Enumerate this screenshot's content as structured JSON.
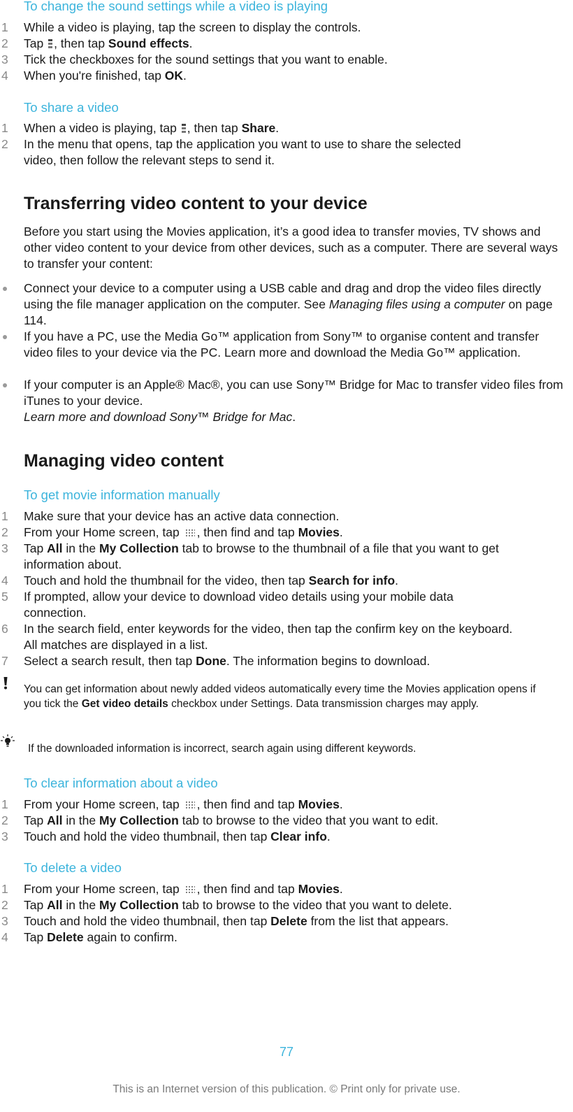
{
  "sound_settings": {
    "heading": "To change the sound settings while a video is playing",
    "steps": [
      {
        "num": "1",
        "parts": [
          "While a video is playing, tap the screen to display the controls."
        ]
      },
      {
        "num": "2",
        "a": "Tap ",
        "b": ", then tap ",
        "bold": "Sound effects",
        "c": "."
      },
      {
        "num": "3",
        "text": "Tick the checkboxes for the sound settings that you want to enable."
      },
      {
        "num": "4",
        "a": "When you're finished, tap ",
        "bold": "OK",
        "c": "."
      }
    ]
  },
  "share_video": {
    "heading": "To share a video",
    "steps": [
      {
        "num": "1",
        "a": "When a video is playing, tap ",
        "b": ", then tap ",
        "bold": "Share",
        "c": "."
      },
      {
        "num": "2",
        "text": "In the menu that opens, tap the application you want to use to share the selected video, then follow the relevant steps to send it."
      }
    ]
  },
  "transferring": {
    "heading": "Transferring video content to your device",
    "intro": "Before you start using the Movies application, it’s a good idea to transfer movies, TV shows and other video content to your device from other devices, such as a computer. There are several ways to transfer your content:",
    "bullets": [
      {
        "a": "Connect your device to a computer using a USB cable and drag and drop the video files directly using the file manager application on the computer. See ",
        "link": "Managing files using a computer",
        "c": " on page 114."
      },
      {
        "text": "If you have a PC, use the Media Go™ application from Sony™ to organise content and transfer video files to your device via the PC. Learn more and download the Media Go™ application."
      },
      {
        "a": "If your computer is an Apple® Mac®, you can use Sony™ Bridge for Mac to transfer video files from iTunes to your device.",
        "link": "Learn more and download Sony™ Bridge for Mac",
        "c": "."
      }
    ]
  },
  "managing": {
    "heading": "Managing video content",
    "get_info": {
      "heading": "To get movie information manually",
      "steps": [
        {
          "num": "1",
          "text": "Make sure that your device has an active data connection."
        },
        {
          "num": "2",
          "a": "From your Home screen, tap ",
          "b": ", then find and tap ",
          "bold": "Movies",
          "c": "."
        },
        {
          "num": "3",
          "a": "Tap ",
          "bold1": "All",
          "b": " in the ",
          "bold2": "My Collection",
          "c": " tab to browse to the thumbnail of a file that you want to get information about."
        },
        {
          "num": "4",
          "a": "Touch and hold the thumbnail for the video, then tap ",
          "bold": "Search for info",
          "c": "."
        },
        {
          "num": "5",
          "text": "If prompted, allow your device to download video details using your mobile data connection."
        },
        {
          "num": "6",
          "text": "In the search field, enter keywords for the video, then tap the confirm key on the keyboard. All matches are displayed in a list."
        },
        {
          "num": "7",
          "a": "Select a search result, then tap ",
          "bold": "Done",
          "c": ". The information begins to download."
        }
      ],
      "note": {
        "a": "You can get information about newly added videos automatically every time the Movies application opens if you tick the ",
        "bold": "Get video details",
        "c": " checkbox under Settings. Data transmission charges may apply."
      },
      "tip": "If the downloaded information is incorrect, search again using different keywords."
    },
    "clear_info": {
      "heading": "To clear information about a video",
      "steps": [
        {
          "num": "1",
          "a": "From your Home screen, tap ",
          "b": ", then find and tap ",
          "bold": "Movies",
          "c": "."
        },
        {
          "num": "2",
          "a": "Tap ",
          "bold1": "All",
          "b": " in the ",
          "bold2": "My Collection",
          "c": " tab to browse to the video that you want to edit."
        },
        {
          "num": "3",
          "a": "Touch and hold the video thumbnail, then tap ",
          "bold": "Clear info",
          "c": "."
        }
      ]
    },
    "delete": {
      "heading": "To delete a video",
      "steps": [
        {
          "num": "1",
          "a": "From your Home screen, tap ",
          "b": ", then find and tap ",
          "bold": "Movies",
          "c": "."
        },
        {
          "num": "2",
          "a": "Tap ",
          "bold1": "All",
          "b": " in the ",
          "bold2": "My Collection",
          "c": " tab to browse to the video that you want to delete."
        },
        {
          "num": "3",
          "a": "Touch and hold the video thumbnail, then tap ",
          "bold": "Delete",
          "c": " from the list that appears."
        },
        {
          "num": "4",
          "a": "Tap ",
          "bold": "Delete",
          "c": " again to confirm."
        }
      ]
    }
  },
  "footer": {
    "page_number": "77",
    "notice": "This is an Internet version of this publication. © Print only for private use."
  }
}
